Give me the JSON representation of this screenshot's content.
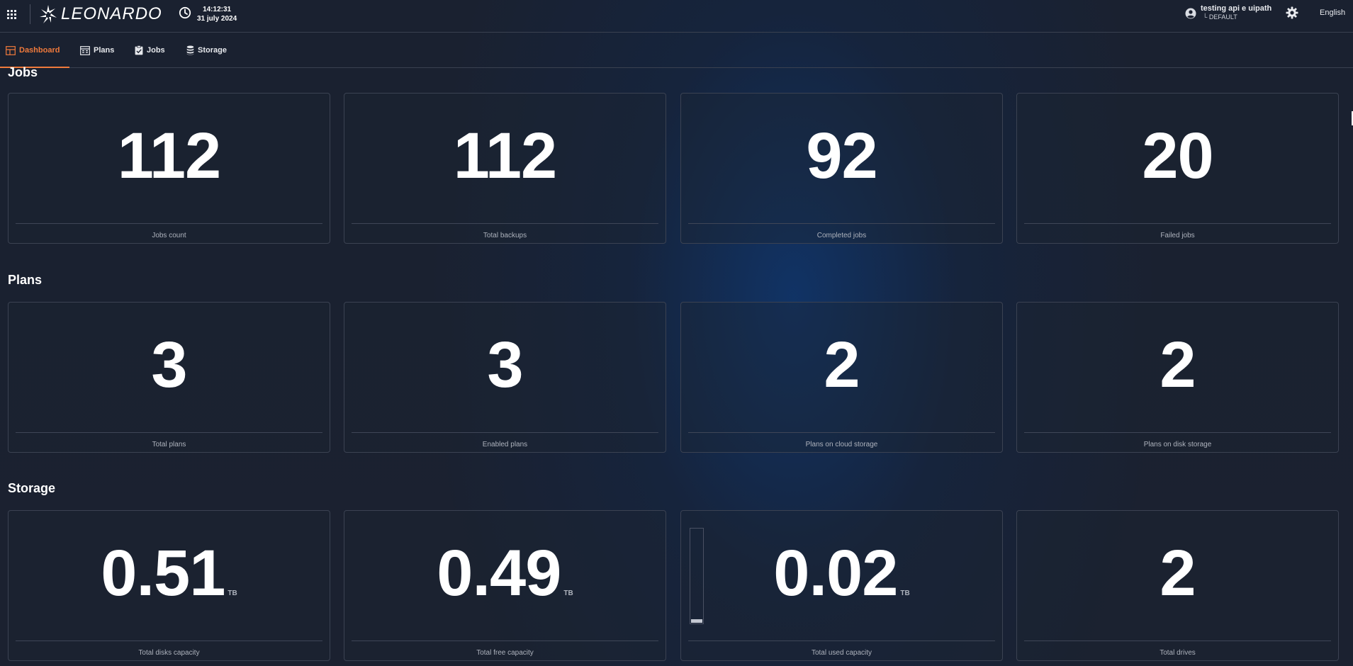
{
  "header": {
    "app_name": "LEONARDO",
    "time": "14:12:31",
    "date": "31 july 2024",
    "user_name": "testing api e uipath",
    "user_profile": "└ DEFAULT",
    "language": "English",
    "icons": [
      "apps-grid-icon",
      "leonardo-logo-icon",
      "clock-icon",
      "account-icon",
      "settings-gear-icon"
    ]
  },
  "nav": {
    "tabs": [
      {
        "label": "Dashboard",
        "icon": "dashboard-icon",
        "active": true
      },
      {
        "label": "Plans",
        "icon": "plans-icon",
        "active": false
      },
      {
        "label": "Jobs",
        "icon": "jobs-clipboard-icon",
        "active": false
      },
      {
        "label": "Storage",
        "icon": "storage-database-icon",
        "active": false
      }
    ],
    "accent_color": "#f07a3c"
  },
  "sections": {
    "jobs": {
      "title": "Jobs",
      "cards": [
        {
          "value": "112",
          "label": "Jobs count"
        },
        {
          "value": "112",
          "label": "Total backups"
        },
        {
          "value": "92",
          "label": "Completed jobs"
        },
        {
          "value": "20",
          "label": "Failed jobs"
        }
      ]
    },
    "plans": {
      "title": "Plans",
      "cards": [
        {
          "value": "3",
          "label": "Total plans"
        },
        {
          "value": "3",
          "label": "Enabled plans"
        },
        {
          "value": "2",
          "label": "Plans on cloud storage"
        },
        {
          "value": "2",
          "label": "Plans on disk storage"
        }
      ]
    },
    "storage": {
      "title": "Storage",
      "cards": [
        {
          "value": "0.51",
          "unit": "TB",
          "label": "Total disks capacity"
        },
        {
          "value": "0.49",
          "unit": "TB",
          "label": "Total free capacity"
        },
        {
          "value": "0.02",
          "unit": "TB",
          "label": "Total used capacity",
          "used_fraction": 0.04
        },
        {
          "value": "2",
          "label": "Total drives"
        }
      ]
    }
  }
}
